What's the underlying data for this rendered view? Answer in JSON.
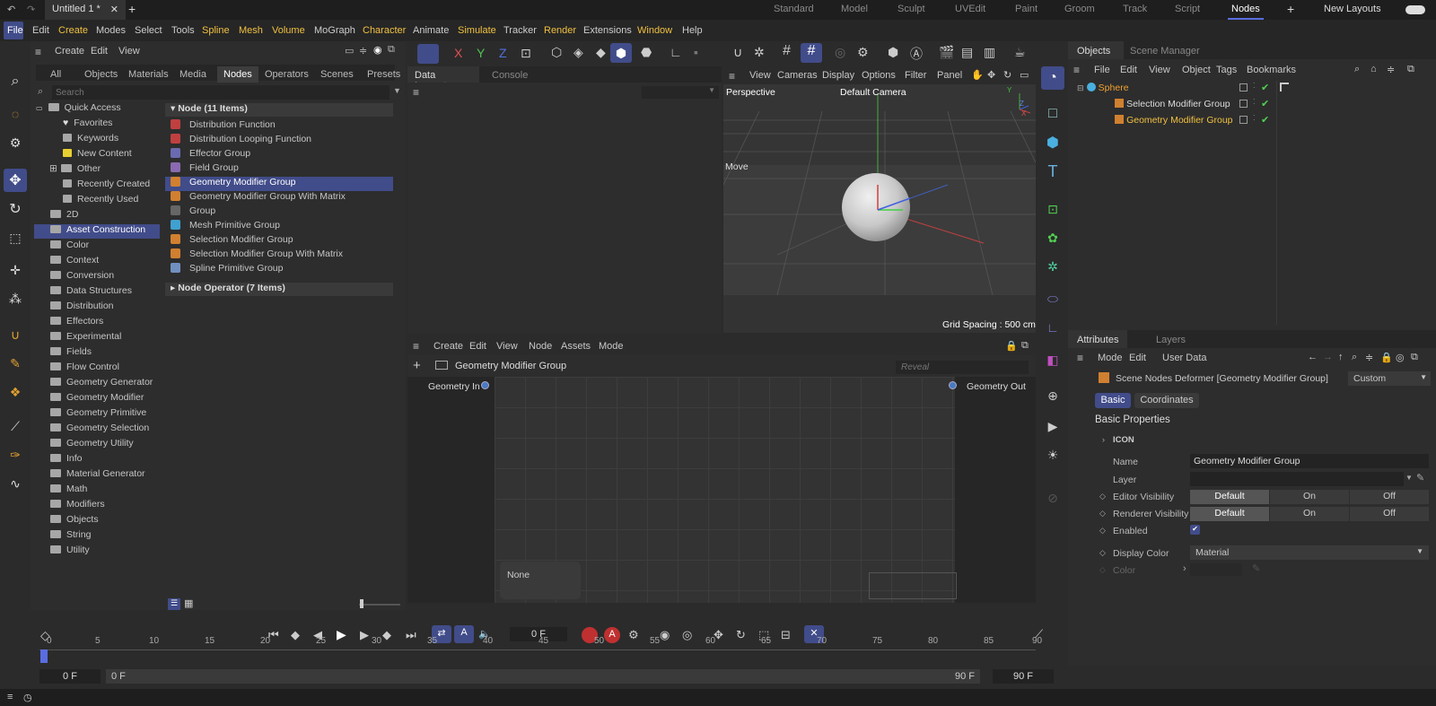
{
  "title_tab": "Untitled 1 *",
  "layouts": [
    "Standard",
    "Model",
    "Sculpt",
    "UVEdit",
    "Paint",
    "Groom",
    "Track",
    "Script",
    "Nodes"
  ],
  "active_layout": "Nodes",
  "new_layouts": "New Layouts",
  "menu": [
    "File",
    "Edit",
    "Create",
    "Modes",
    "Select",
    "Tools",
    "Spline",
    "Mesh",
    "Volume",
    "MoGraph",
    "Character",
    "Animate",
    "Simulate",
    "Tracker",
    "Render",
    "Extensions",
    "Window",
    "Help"
  ],
  "asset": {
    "menu": [
      "Create",
      "Edit",
      "View"
    ],
    "tabs": [
      "All",
      "Objects",
      "Materials",
      "Media",
      "Nodes",
      "Operators",
      "Scenes",
      "Presets"
    ],
    "search_placeholder": "Search",
    "tree": [
      "Quick Access",
      "Favorites",
      "Keywords",
      "New Content",
      "Other",
      "Recently Created",
      "Recently Used",
      "2D",
      "Asset Construction",
      "Color",
      "Context",
      "Conversion",
      "Data Structures",
      "Distribution",
      "Effectors",
      "Experimental",
      "Fields",
      "Flow Control",
      "Geometry Generator",
      "Geometry Modifier",
      "Geometry Primitive",
      "Geometry Selection",
      "Geometry Utility",
      "Info",
      "Material Generator",
      "Math",
      "Modifiers",
      "Objects",
      "String",
      "Utility"
    ],
    "node_header": "Node (11 Items)",
    "nodes": [
      "Distribution Function",
      "Distribution Looping Function",
      "Effector Group",
      "Field Group",
      "Geometry Modifier Group",
      "Geometry Modifier Group With Matrix",
      "Group",
      "Mesh Primitive Group",
      "Selection Modifier Group",
      "Selection Modifier Group With Matrix",
      "Spline Primitive Group"
    ],
    "operator_header": "Node Operator (7 Items)"
  },
  "inspector_tabs": [
    "Data Inspector",
    "Console"
  ],
  "viewport": {
    "menu": [
      "View",
      "Cameras",
      "Display",
      "Options",
      "Filter",
      "Panel"
    ],
    "perspective": "Perspective",
    "camera": "Default Camera",
    "move": "Move",
    "grid": "Grid Spacing : 500 cm",
    "axis": [
      "Y",
      "Z",
      "X"
    ]
  },
  "node_editor": {
    "menu": [
      "Create",
      "Edit",
      "View",
      "Node",
      "Assets",
      "Mode"
    ],
    "breadcrumb": "Geometry Modifier Group",
    "reveal_placeholder": "Reveal",
    "geo_in": "Geometry In",
    "geo_out": "Geometry Out",
    "none": "None"
  },
  "objects": {
    "tabs": [
      "Objects",
      "Scene Manager"
    ],
    "menu": [
      "File",
      "Edit",
      "View",
      "Object",
      "Tags",
      "Bookmarks"
    ],
    "items": [
      "Sphere",
      "Selection Modifier Group",
      "Geometry Modifier Group"
    ]
  },
  "attributes": {
    "tabs": [
      "Attributes",
      "Layers"
    ],
    "menu": [
      "Mode",
      "Edit",
      "User Data"
    ],
    "object_name": "Scene Nodes Deformer [Geometry Modifier Group]",
    "preset": "Custom",
    "subtabs": [
      "Basic",
      "Coordinates"
    ],
    "section": "Basic Properties",
    "icon_label": "ICON",
    "name_label": "Name",
    "name_value": "Geometry Modifier Group",
    "layer_label": "Layer",
    "editor_vis": "Editor Visibility",
    "renderer_vis": "Renderer Visibility",
    "vis_options": [
      "Default",
      "On",
      "Off"
    ],
    "enabled": "Enabled",
    "display_color": "Display Color",
    "display_color_value": "Material",
    "color": "Color"
  },
  "timeline": {
    "frame": "0 F",
    "ticks": [
      "0",
      "5",
      "10",
      "15",
      "20",
      "25",
      "30",
      "35",
      "40",
      "45",
      "50",
      "55",
      "60",
      "65",
      "70",
      "75",
      "80",
      "85",
      "90"
    ],
    "start": "0 F",
    "start2": "0 F",
    "end": "90 F",
    "end2": "90 F"
  },
  "colors": {
    "accent": "#414c8a",
    "highlight": "#f0c040",
    "bg": "#2b2b2b"
  }
}
